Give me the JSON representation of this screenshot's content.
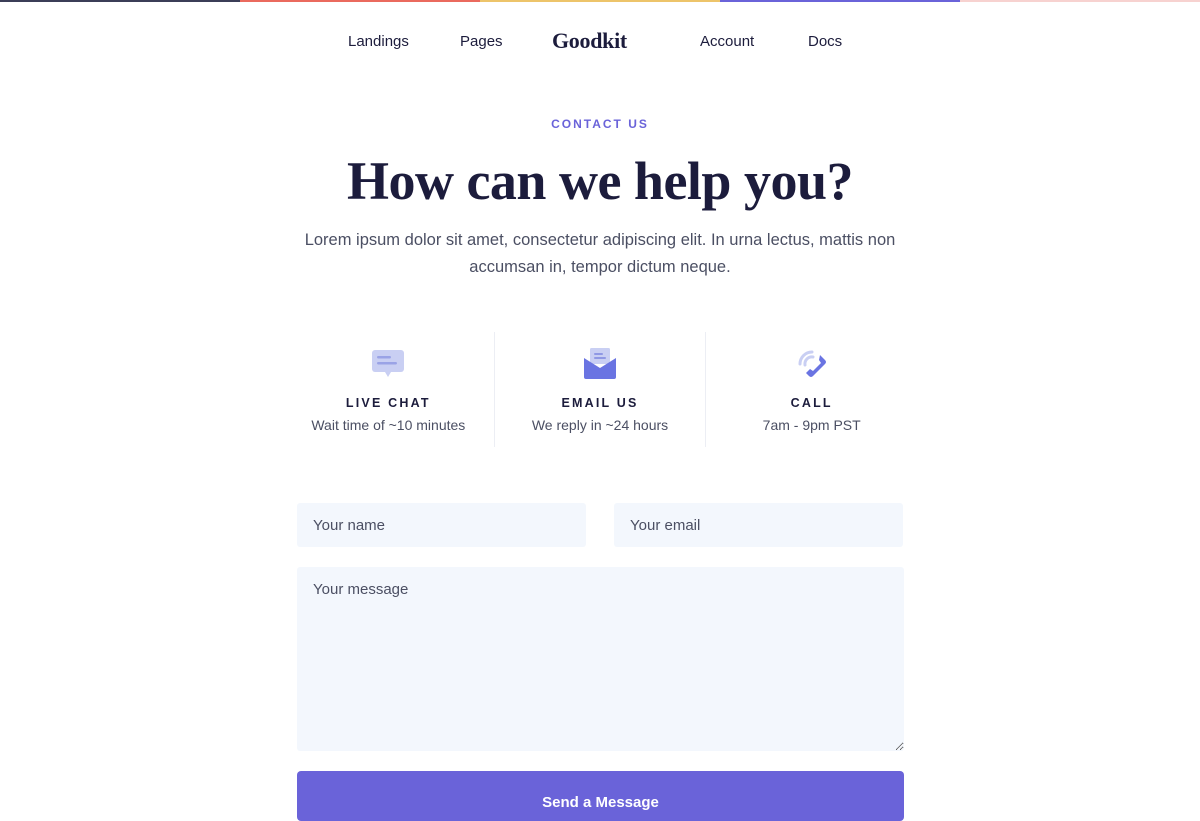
{
  "top_stripe_colors": [
    "#3b3d57",
    "#ea6a5e",
    "#edc46a",
    "#6a63d9",
    "#f7d2d0"
  ],
  "nav": {
    "links_left": [
      "Landings",
      "Pages"
    ],
    "logo": "Goodkit",
    "links_right": [
      "Account",
      "Docs"
    ]
  },
  "hero": {
    "eyebrow": "CONTACT US",
    "title": "How can we help you?",
    "lead": "Lorem ipsum dolor sit amet, consectetur adipiscing elit. In urna lectus, mattis non accumsan in, tempor dictum neque."
  },
  "channels": [
    {
      "icon": "chat-bubble-icon",
      "title": "LIVE CHAT",
      "subtitle": "Wait time of ~10 minutes"
    },
    {
      "icon": "envelope-icon",
      "title": "EMAIL US",
      "subtitle": "We reply in ~24 hours"
    },
    {
      "icon": "phone-icon",
      "title": "CALL",
      "subtitle": "7am - 9pm PST"
    }
  ],
  "form": {
    "name_placeholder": "Your name",
    "email_placeholder": "Your email",
    "message_placeholder": "Your message",
    "submit_label": "Send a Message"
  },
  "colors": {
    "accent": "#6a63d9",
    "ink": "#1c1c3c",
    "field_bg": "#f3f7fd"
  }
}
